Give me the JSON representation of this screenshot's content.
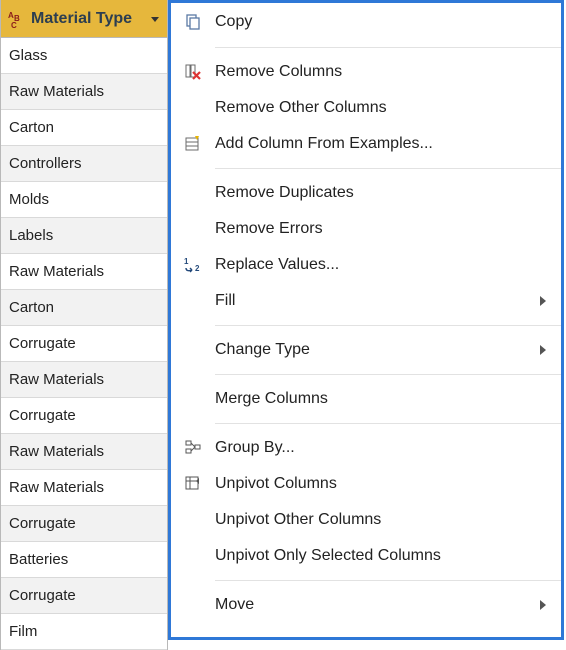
{
  "column": {
    "header": "Material Type",
    "type_icon": "text-type-icon",
    "rows": [
      "Glass",
      "Raw Materials",
      "Carton",
      "Controllers",
      "Molds",
      "Labels",
      "Raw Materials",
      "Carton",
      "Corrugate",
      "Raw Materials",
      "Corrugate",
      "Raw Materials",
      "Raw Materials",
      "Corrugate",
      "Batteries",
      "Corrugate",
      "Film"
    ]
  },
  "menu": {
    "copy": "Copy",
    "remove_columns": "Remove Columns",
    "remove_other_columns": "Remove Other Columns",
    "add_col_examples": "Add Column From Examples...",
    "remove_duplicates": "Remove Duplicates",
    "remove_errors": "Remove Errors",
    "replace_values": "Replace Values...",
    "fill": "Fill",
    "change_type": "Change Type",
    "merge_columns": "Merge Columns",
    "group_by": "Group By...",
    "unpivot_columns": "Unpivot Columns",
    "unpivot_other": "Unpivot Other Columns",
    "unpivot_selected": "Unpivot Only Selected Columns",
    "move": "Move"
  },
  "colors": {
    "header_bg": "#e6b73c",
    "menu_border": "#2f78d7"
  }
}
